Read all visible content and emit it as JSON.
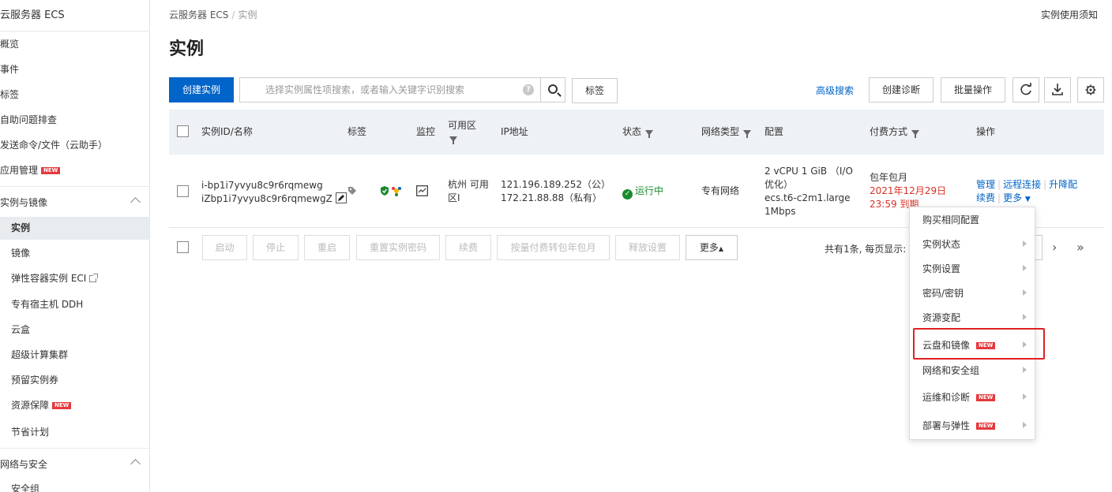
{
  "sidebar": {
    "title": "云服务器 ECS",
    "items": [
      {
        "label": "概览"
      },
      {
        "label": "事件"
      },
      {
        "label": "标签"
      },
      {
        "label": "自助问题排查"
      },
      {
        "label": "发送命令/文件（云助手）"
      },
      {
        "label": "应用管理",
        "badge": "NEW"
      }
    ],
    "group1": {
      "label": "实例与镜像",
      "items": [
        {
          "label": "实例",
          "active": true
        },
        {
          "label": "镜像"
        },
        {
          "label": "弹性容器实例 ECI"
        },
        {
          "label": "专有宿主机 DDH"
        },
        {
          "label": "云盒"
        },
        {
          "label": "超级计算集群"
        },
        {
          "label": "预留实例券"
        },
        {
          "label": "资源保障",
          "badge": "NEW"
        },
        {
          "label": "节省计划"
        }
      ]
    },
    "group2": {
      "label": "网络与安全",
      "items": [
        {
          "label": "安全组"
        }
      ]
    }
  },
  "header": {
    "breadcrumb": [
      "云服务器 ECS",
      "实例"
    ],
    "help_link": "实例使用须知",
    "title": "实例"
  },
  "toolbar": {
    "create_label": "创建实例",
    "search_placeholder": "选择实例属性项搜索，或者输入关键字识别搜索",
    "tag_label": "标签",
    "advanced_search": "高级搜索",
    "diagnose_label": "创建诊断",
    "batch_label": "批量操作"
  },
  "table": {
    "headers": {
      "id": "实例ID/名称",
      "tag": "标签",
      "monitor": "监控",
      "zone": "可用区",
      "ip": "IP地址",
      "status": "状态",
      "network": "网络类型",
      "config": "配置",
      "billing": "付费方式",
      "actions": "操作"
    },
    "row": {
      "id": "i-bp1i7yvyu8c9r6rqmewg",
      "name": "iZbp1i7yvyu8c9r6rqmewgZ",
      "zone": "杭州 可用区I",
      "ip_public": "121.196.189.252（公）",
      "ip_private": "172.21.88.88（私有）",
      "status": "运行中",
      "network": "专有网络",
      "config_line1": "2 vCPU 1 GiB （I/O优化）",
      "config_type": "ecs.t6-c2m1.large",
      "config_bw": "1Mbps",
      "billing_type": "包年包月",
      "billing_expire": "2021年12月29日 23:59 到期",
      "actions": {
        "manage": "管理",
        "remote": "远程连接",
        "upgrade": "升降配",
        "renew": "续费",
        "more": "更多"
      }
    }
  },
  "bottom_bar": {
    "buttons": [
      "启动",
      "停止",
      "重启",
      "重置实例密码",
      "续费",
      "按量付费转包年包月",
      "释放设置"
    ],
    "more_label": "更多",
    "pager_text": "共有1条, 每页显示:"
  },
  "more_menu": {
    "items": [
      {
        "label": "购买相同配置",
        "submenu": false
      },
      {
        "label": "实例状态",
        "submenu": true
      },
      {
        "label": "实例设置",
        "submenu": true
      },
      {
        "label": "密码/密钥",
        "submenu": true
      },
      {
        "label": "资源变配",
        "submenu": true
      },
      {
        "label": "云盘和镜像",
        "submenu": true,
        "badge": "NEW",
        "highlighted": true
      },
      {
        "label": "网络和安全组",
        "submenu": true
      },
      {
        "label": "运维和诊断",
        "submenu": true,
        "badge": "NEW"
      },
      {
        "label": "部署与弹性",
        "submenu": true,
        "badge": "NEW"
      }
    ]
  },
  "colors": {
    "primary": "#0064c8",
    "running": "#1a8a2e",
    "expire": "#d93026",
    "badge": "#e4393c",
    "highlight_box": "#e02020"
  }
}
